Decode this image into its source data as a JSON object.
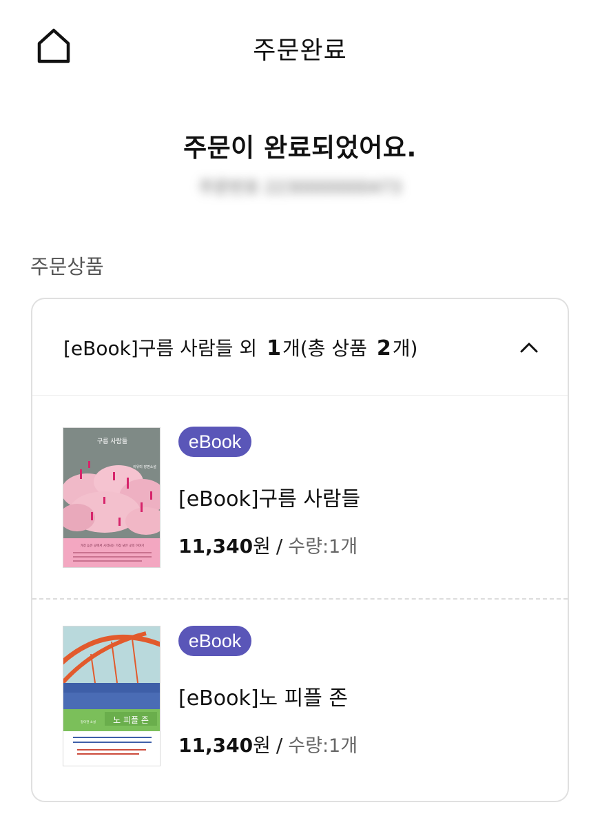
{
  "header": {
    "title": "주문완료",
    "home_icon": "home-icon"
  },
  "completion": {
    "message": "주문이 완료되었어요.",
    "order_number_text": "주문번호 2230000000473"
  },
  "section": {
    "label": "주문상품"
  },
  "order_summary": {
    "prefix": "[eBook]구름 사람들 외",
    "extra_count": "1",
    "extra_unit": "개(총 상품",
    "total_count": "2",
    "total_unit": "개)",
    "expanded_icon": "chevron-up-icon"
  },
  "items": [
    {
      "badge": "eBook",
      "title": "[eBook]구름 사람들",
      "price": "11,340",
      "currency": "원",
      "separator": "/",
      "quantity": "수량:1개",
      "cover": {
        "title": "구름 사람들",
        "author": "이유미 장편소설",
        "tagline": "가장 높은 곳에서 시작되는 가장 낮은 곳의 이야기"
      }
    },
    {
      "badge": "eBook",
      "title": "[eBook]노 피플 존",
      "price": "11,340",
      "currency": "원",
      "separator": "/",
      "quantity": "수량:1개",
      "cover": {
        "title": "노 피플 존",
        "author": "정이현 소설"
      }
    }
  ],
  "colors": {
    "badge": "#5a56b8",
    "cover1_bg": "#7f8a86",
    "cover1_cloud": "#f2b8c9",
    "cover1_band": "#f3a7c1",
    "cover2_sky": "#b9d9dc",
    "cover2_bridge": "#e25a2c",
    "cover2_blue": "#3e5fa8",
    "cover2_green": "#7bbf5a"
  }
}
